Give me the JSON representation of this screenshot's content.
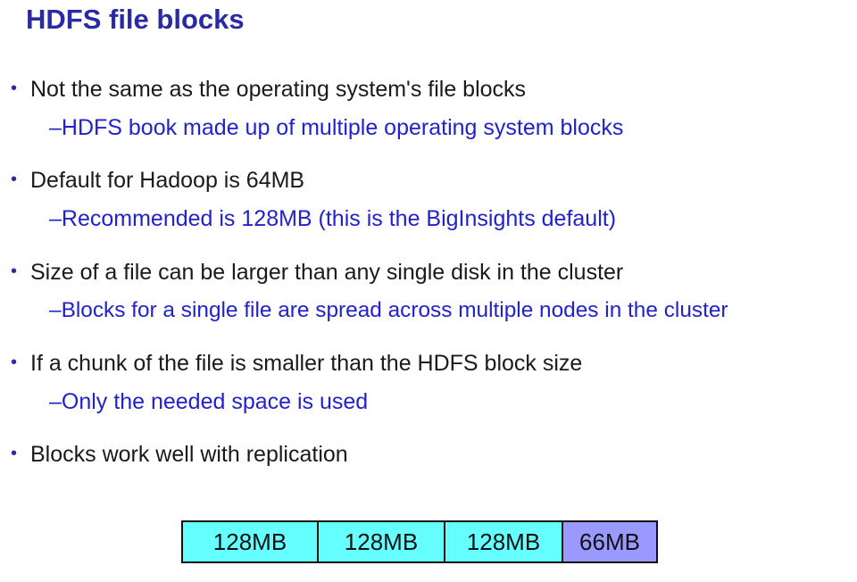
{
  "title": "HDFS file blocks",
  "bullets": [
    {
      "text": "Not the same as the operating system's file blocks",
      "sub": "–HDFS book made up of multiple operating system blocks"
    },
    {
      "text": "Default for Hadoop is 64MB",
      "sub": "–Recommended is 128MB (this is the BigInsights default)"
    },
    {
      "text": "Size of a file can be larger than any single disk in the cluster",
      "sub": "–Blocks for a single file are spread across multiple nodes in the cluster"
    },
    {
      "text": "If a chunk of the file is smaller than the HDFS block size",
      "sub": "–Only the needed space is used"
    },
    {
      "text": "Blocks work well with replication",
      "sub": ""
    }
  ],
  "bullet_glyph": "•",
  "blocks": [
    {
      "label": "128MB",
      "color": "#66ffff"
    },
    {
      "label": "128MB",
      "color": "#66ffff"
    },
    {
      "label": "128MB",
      "color": "#66ffff"
    },
    {
      "label": "66MB",
      "color": "#9999ff"
    }
  ],
  "colors": {
    "title": "#2a2aa6",
    "sub_text": "#2222cc",
    "main_text": "#1a1a1a"
  }
}
